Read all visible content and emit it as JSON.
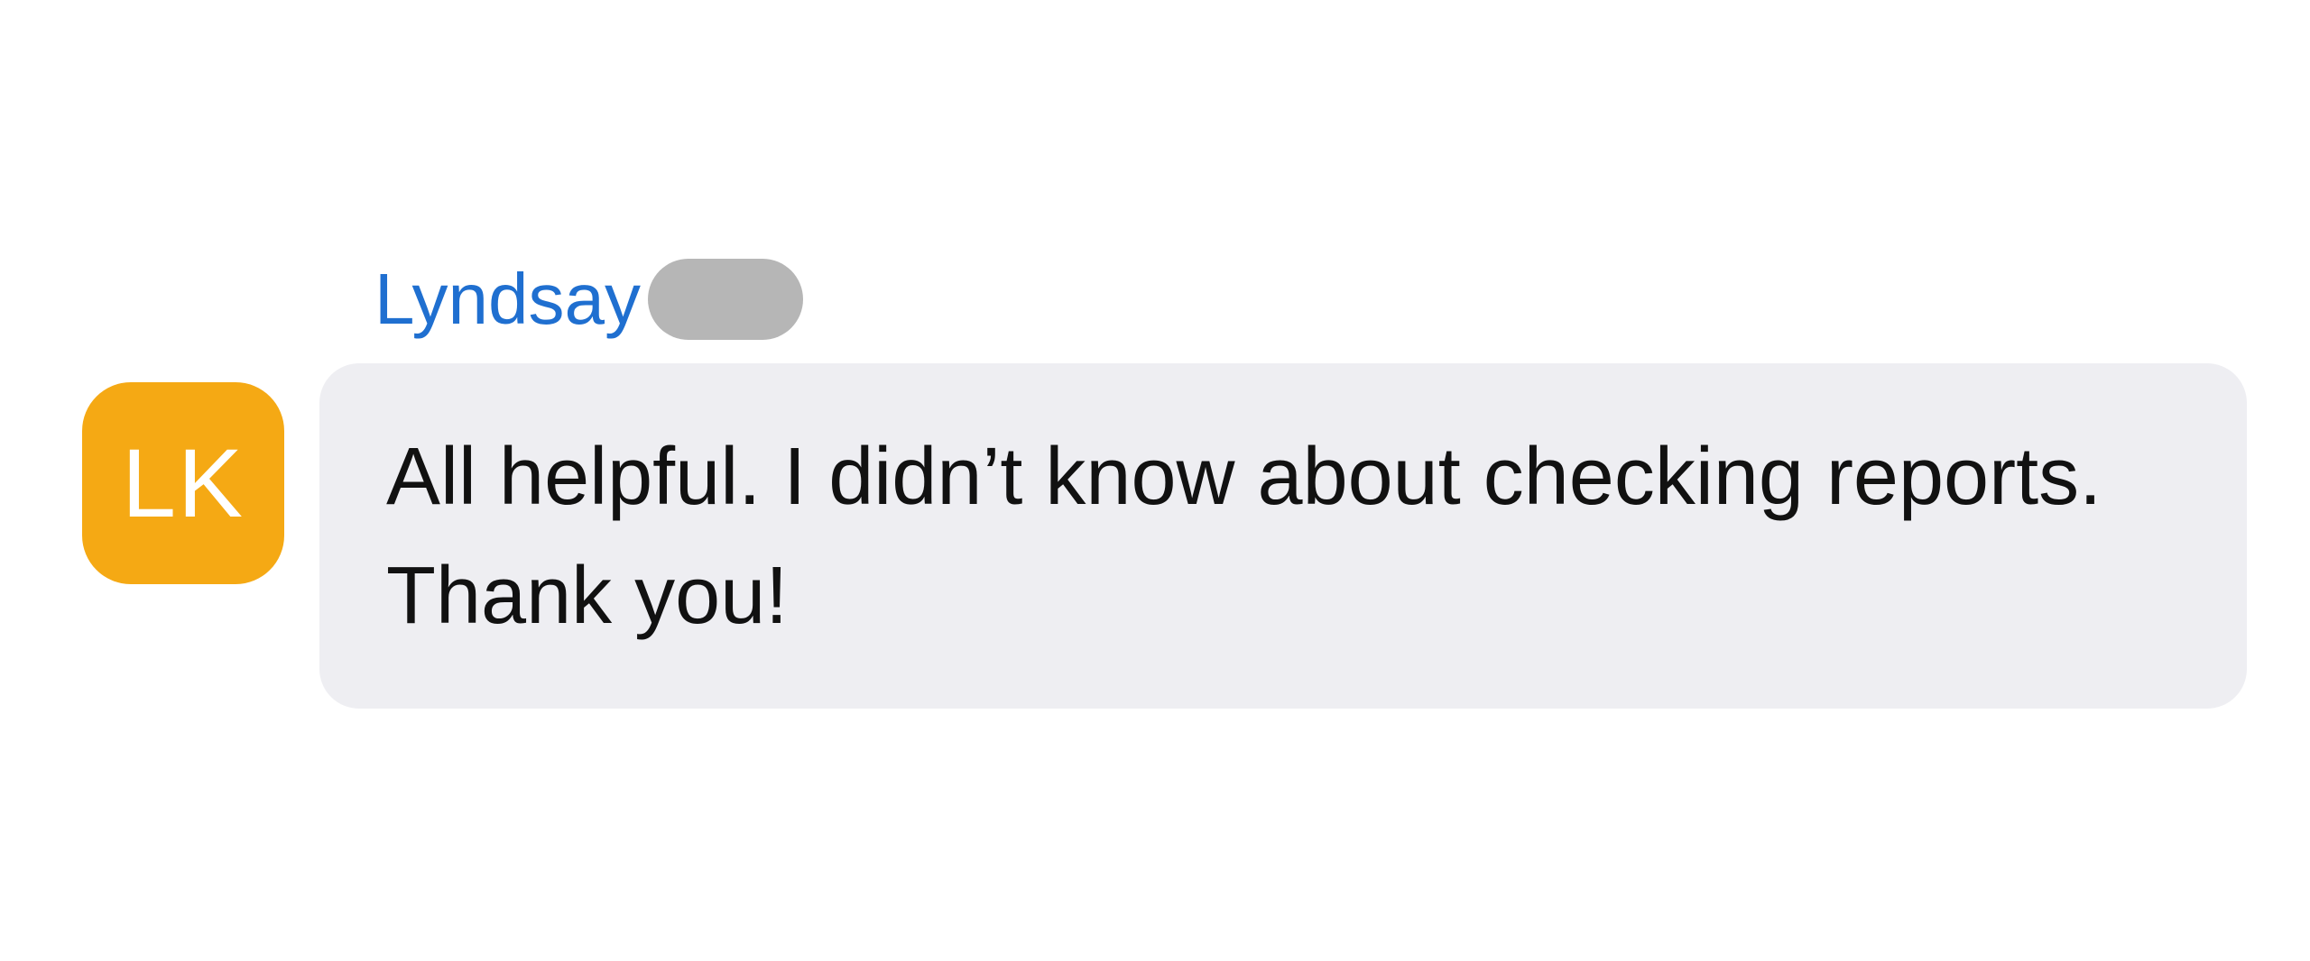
{
  "message": {
    "sender_name": "Lyndsay",
    "avatar_initials": "LK",
    "text": "All helpful. I didn’t know about checking reports. Thank you!"
  },
  "colors": {
    "sender_name": "#1f6fd0",
    "redacted_pill": "#b6b6b6",
    "avatar_background": "#f5a914",
    "bubble_background": "#eeeef2"
  }
}
